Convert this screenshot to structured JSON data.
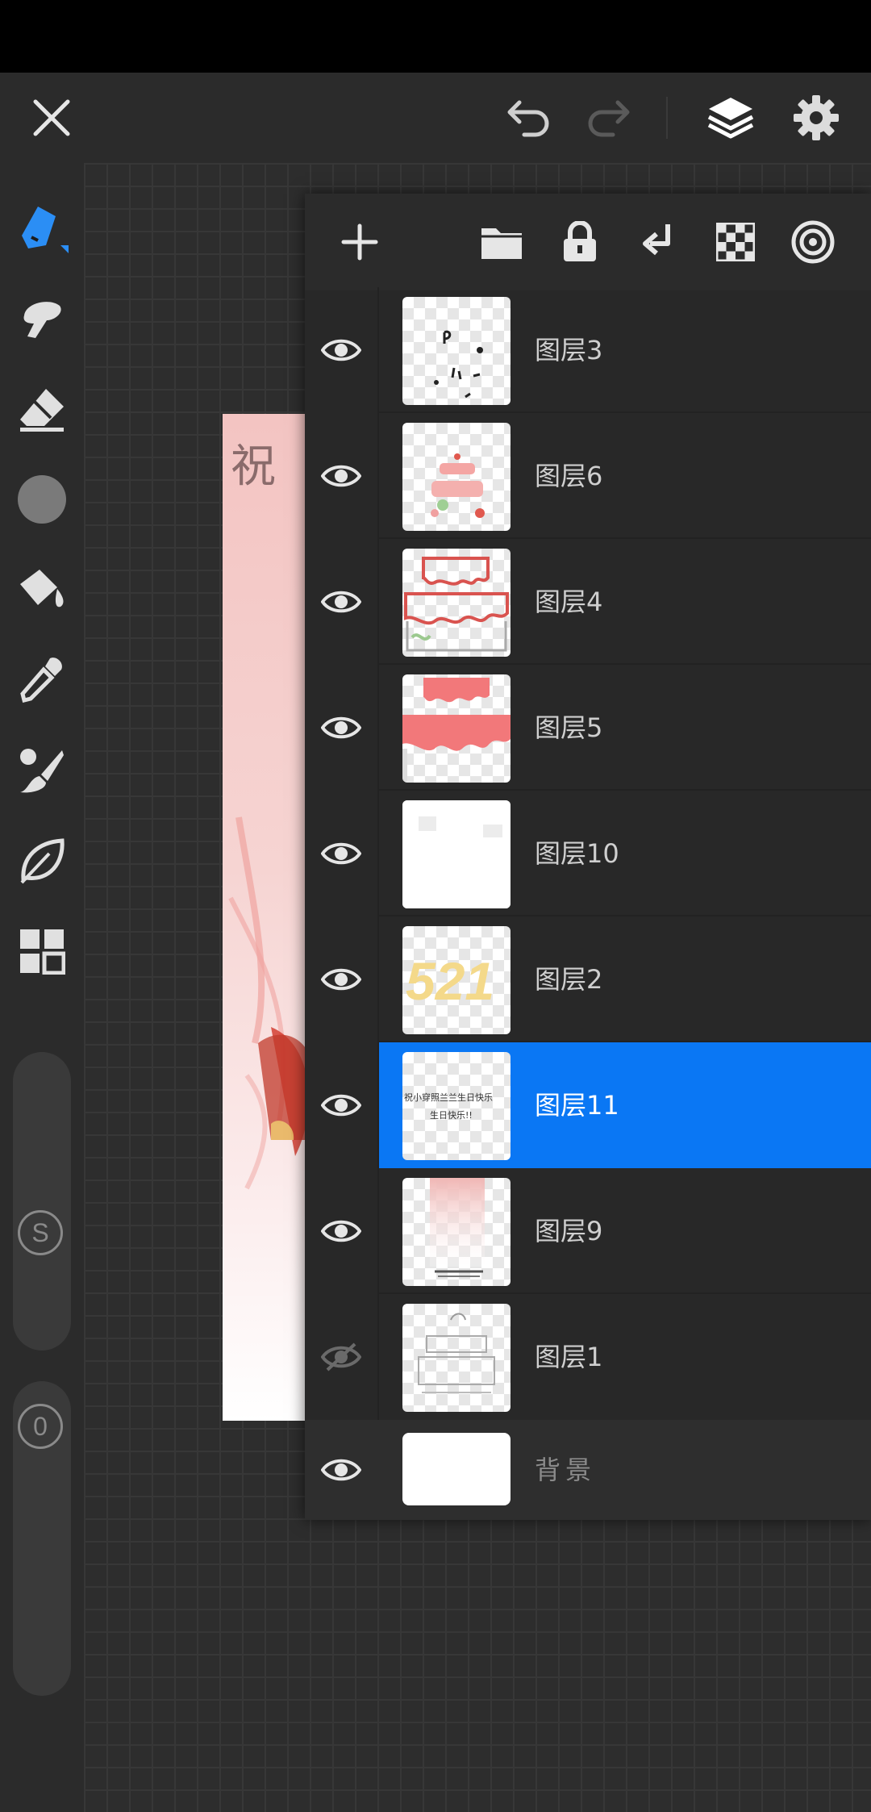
{
  "toolbar": {
    "close_icon": "close-icon",
    "undo_icon": "undo-icon",
    "redo_icon": "redo-icon",
    "layers_icon": "layers-icon",
    "settings_icon": "gear-icon"
  },
  "sidebar": {
    "tools": [
      {
        "name": "pencil",
        "active": true
      },
      {
        "name": "smudge"
      },
      {
        "name": "eraser"
      },
      {
        "name": "color"
      },
      {
        "name": "fill"
      },
      {
        "name": "eyedropper"
      },
      {
        "name": "brush"
      },
      {
        "name": "leaf"
      },
      {
        "name": "grid"
      }
    ],
    "size_slider_label": "S",
    "opacity_slider_label": "0"
  },
  "canvas": {
    "artboard_text": "祝"
  },
  "layers_panel": {
    "header_icons": [
      "add-icon",
      "folder-icon",
      "lock-icon",
      "merge-down-icon",
      "checker-icon",
      "target-icon"
    ],
    "layers": [
      {
        "name": "图层3",
        "visible": true,
        "selected": false
      },
      {
        "name": "图层6",
        "visible": true,
        "selected": false
      },
      {
        "name": "图层4",
        "visible": true,
        "selected": false
      },
      {
        "name": "图层5",
        "visible": true,
        "selected": false
      },
      {
        "name": "图层10",
        "visible": true,
        "selected": false
      },
      {
        "name": "图层2",
        "visible": true,
        "selected": false
      },
      {
        "name": "图层11",
        "visible": true,
        "selected": true
      },
      {
        "name": "图层9",
        "visible": true,
        "selected": false
      },
      {
        "name": "图层1",
        "visible": false,
        "selected": false
      }
    ],
    "background_layer": {
      "name": "背景",
      "visible": true
    },
    "thumb_texts": {
      "layer11_line1": "祝小穿照兰兰生日快乐",
      "layer11_line2": "生日快乐!!",
      "layer2": "521"
    }
  },
  "colors": {
    "accent": "#0a77f4",
    "active_tool": "#2b8ef5",
    "cake_red": "#f2787a"
  }
}
